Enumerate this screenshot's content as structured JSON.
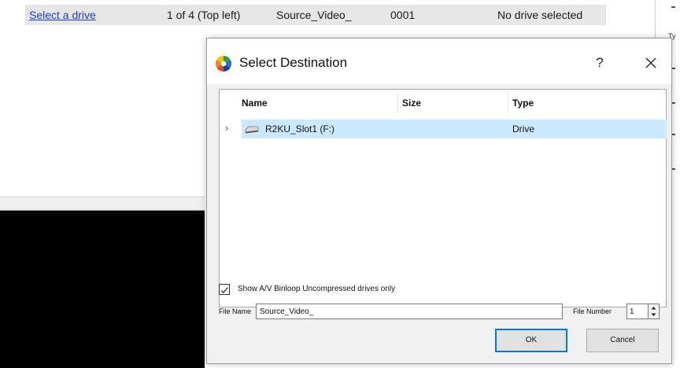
{
  "background": {
    "select_drive_link": "Select a drive",
    "position": "1 of 4 (Top left)",
    "source_name": "Source_Video_",
    "number": "0001",
    "status": "No drive selected",
    "right_panel_text": "Ty"
  },
  "dialog": {
    "title": "Select Destination",
    "help_label": "?",
    "columns": {
      "name": "Name",
      "size": "Size",
      "type": "Type"
    },
    "rows": [
      {
        "name": "R2KU_Slot1 (F:)",
        "size": "",
        "type": "Drive",
        "selected": true
      }
    ],
    "show_drives_only": {
      "label": "Show A/V Binloop Uncompressed drives only",
      "checked": true
    },
    "file_name": {
      "label": "File Name",
      "value": "Source_Video_"
    },
    "file_number": {
      "label": "File Number",
      "value": "1"
    },
    "ok_label": "OK",
    "cancel_label": "Cancel"
  },
  "colors": {
    "selection": "#cce8ff",
    "link": "#1a3fd6",
    "default_button_border": "#0078d7"
  },
  "icons": {
    "app": "color-wheel-icon",
    "close": "close-icon",
    "expand": "chevron-right-icon",
    "drive": "drive-icon",
    "check": "checkmark-icon"
  }
}
